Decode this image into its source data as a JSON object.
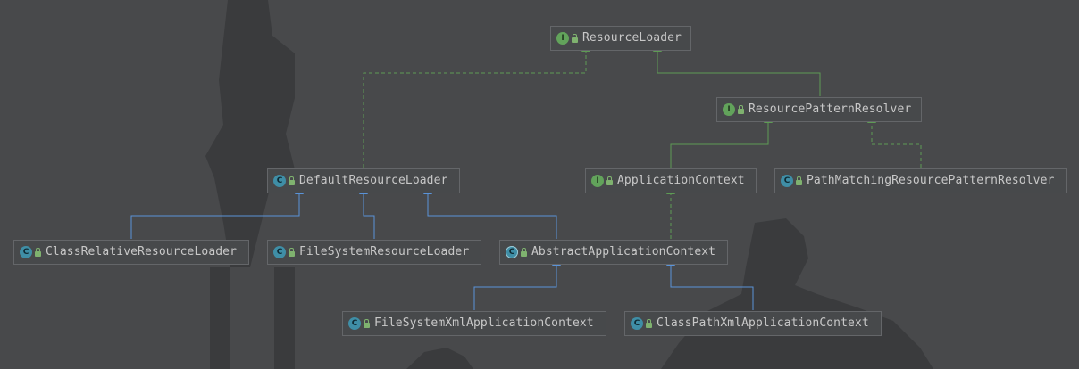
{
  "colors": {
    "background": "#48494b",
    "node_border": "#646669",
    "text": "#c8c8c8",
    "implements_edge": "#5e9b54",
    "extends_edge": "#5a93d8",
    "interface_badge": "#62a35b",
    "class_badge": "#3f8ea6"
  },
  "nodes": [
    {
      "id": "resource-loader",
      "kind": "interface",
      "label": "ResourceLoader"
    },
    {
      "id": "resource-pattern-resolver",
      "kind": "interface",
      "label": "ResourcePatternResolver"
    },
    {
      "id": "default-resource-loader",
      "kind": "class",
      "label": "DefaultResourceLoader"
    },
    {
      "id": "application-context",
      "kind": "interface",
      "label": "ApplicationContext"
    },
    {
      "id": "path-matching-resource-pattern-resolver",
      "kind": "class",
      "label": "PathMatchingResourcePatternResolver"
    },
    {
      "id": "class-relative-resource-loader",
      "kind": "class",
      "label": "ClassRelativeResourceLoader"
    },
    {
      "id": "file-system-resource-loader",
      "kind": "class",
      "label": "FileSystemResourceLoader"
    },
    {
      "id": "abstract-application-context",
      "kind": "abstract",
      "label": "AbstractApplicationContext"
    },
    {
      "id": "file-system-xml-application-context",
      "kind": "class",
      "label": "FileSystemXmlApplicationContext"
    },
    {
      "id": "class-path-xml-application-context",
      "kind": "class",
      "label": "ClassPathXmlApplicationContext"
    }
  ],
  "edges": [
    {
      "from": "default-resource-loader",
      "to": "resource-loader",
      "type": "implements"
    },
    {
      "from": "resource-pattern-resolver",
      "to": "resource-loader",
      "type": "extends-interface"
    },
    {
      "from": "application-context",
      "to": "resource-pattern-resolver",
      "type": "extends-interface"
    },
    {
      "from": "path-matching-resource-pattern-resolver",
      "to": "resource-pattern-resolver",
      "type": "implements"
    },
    {
      "from": "abstract-application-context",
      "to": "application-context",
      "type": "implements"
    },
    {
      "from": "class-relative-resource-loader",
      "to": "default-resource-loader",
      "type": "extends"
    },
    {
      "from": "file-system-resource-loader",
      "to": "default-resource-loader",
      "type": "extends"
    },
    {
      "from": "abstract-application-context",
      "to": "default-resource-loader",
      "type": "extends"
    },
    {
      "from": "file-system-xml-application-context",
      "to": "abstract-application-context",
      "type": "extends"
    },
    {
      "from": "class-path-xml-application-context",
      "to": "abstract-application-context",
      "type": "extends"
    }
  ]
}
